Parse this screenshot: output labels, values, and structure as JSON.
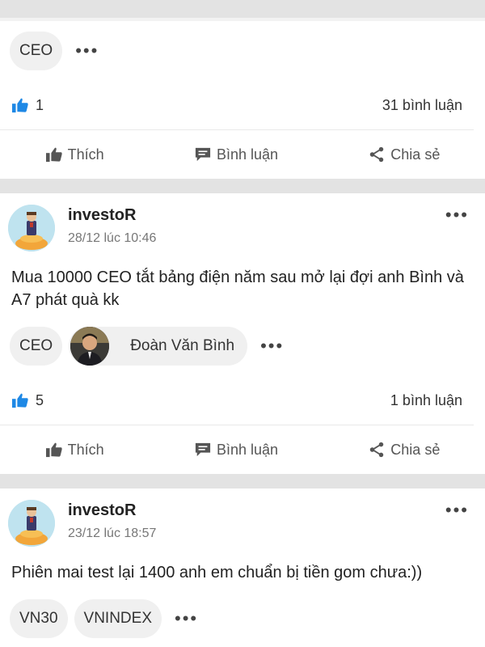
{
  "top_post": {
    "tags": [
      "CEO"
    ],
    "likes": "1",
    "comments": "31 bình luận"
  },
  "posts": [
    {
      "author": "investoR",
      "time": "28/12 lúc 10:46",
      "text": "Mua 10000 CEO tắt bảng điện năm sau mở lại đợi anh Bình và A7 phát quà kk",
      "tags": [
        "CEO"
      ],
      "person_tag": "Đoàn Văn Bình",
      "likes": "5",
      "comments": "1 bình luận"
    },
    {
      "author": "investoR",
      "time": "23/12 lúc 18:57",
      "text": "Phiên mai test lại 1400 anh em chuẩn bị tiền gom chưa:))",
      "tags": [
        "VN30",
        "VNINDEX"
      ]
    }
  ],
  "actions": {
    "like": "Thích",
    "comment": "Bình luận",
    "share": "Chia sẻ"
  },
  "colors": {
    "like_blue": "#1e88e5",
    "separator": "#e3e3e3",
    "tag_bg": "#f0f0f0"
  }
}
